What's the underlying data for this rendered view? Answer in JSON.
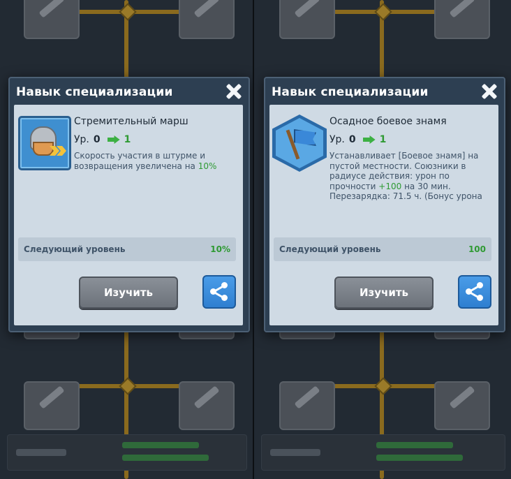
{
  "left": {
    "dialog_title": "Навык специализации",
    "skill_name": "Стремительный марш",
    "level_prefix": "Ур.",
    "level_current": "0",
    "level_next": "1",
    "description_main": "Скорость участия в штурме и возвращения увеличена на ",
    "description_value": "10%",
    "next_level_label": "Следующий уровень",
    "next_level_value": "10%",
    "study_button": "Изучить",
    "share_icon": "share-icon",
    "close_icon": "close-icon"
  },
  "right": {
    "dialog_title": "Навык специализации",
    "skill_name": "Осадное боевое знамя",
    "level_prefix": "Ур.",
    "level_current": "0",
    "level_next": "1",
    "description_part1": "Устанавливает [Боевое знамя] на пустой местности. Союзники в радиусе действия: урон по прочности ",
    "description_value": "+100",
    "description_part2": " на 30 мин. Перезарядка: 71.5 ч. (Бонус урона",
    "next_level_label": "Следующий уровень",
    "next_level_value": "100",
    "study_button": "Изучить",
    "share_icon": "share-icon",
    "close_icon": "close-icon"
  },
  "colors": {
    "accent_green": "#2f9a33",
    "dialog_header": "#2d3f52",
    "content_bg": "#cfdae4",
    "share_blue": "#2f7fd0"
  }
}
